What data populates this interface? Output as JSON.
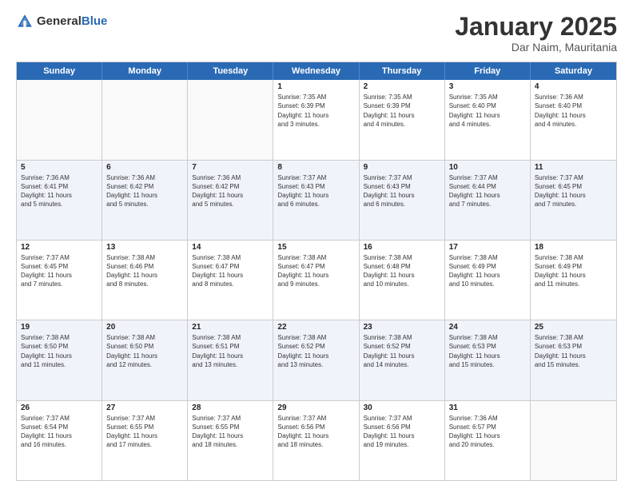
{
  "logo": {
    "general": "General",
    "blue": "Blue"
  },
  "header": {
    "month": "January 2025",
    "location": "Dar Naim, Mauritania"
  },
  "days": [
    "Sunday",
    "Monday",
    "Tuesday",
    "Wednesday",
    "Thursday",
    "Friday",
    "Saturday"
  ],
  "rows": [
    [
      {
        "day": "",
        "lines": []
      },
      {
        "day": "",
        "lines": []
      },
      {
        "day": "",
        "lines": []
      },
      {
        "day": "1",
        "lines": [
          "Sunrise: 7:35 AM",
          "Sunset: 6:39 PM",
          "Daylight: 11 hours",
          "and 3 minutes."
        ]
      },
      {
        "day": "2",
        "lines": [
          "Sunrise: 7:35 AM",
          "Sunset: 6:39 PM",
          "Daylight: 11 hours",
          "and 4 minutes."
        ]
      },
      {
        "day": "3",
        "lines": [
          "Sunrise: 7:35 AM",
          "Sunset: 6:40 PM",
          "Daylight: 11 hours",
          "and 4 minutes."
        ]
      },
      {
        "day": "4",
        "lines": [
          "Sunrise: 7:36 AM",
          "Sunset: 6:40 PM",
          "Daylight: 11 hours",
          "and 4 minutes."
        ]
      }
    ],
    [
      {
        "day": "5",
        "lines": [
          "Sunrise: 7:36 AM",
          "Sunset: 6:41 PM",
          "Daylight: 11 hours",
          "and 5 minutes."
        ]
      },
      {
        "day": "6",
        "lines": [
          "Sunrise: 7:36 AM",
          "Sunset: 6:42 PM",
          "Daylight: 11 hours",
          "and 5 minutes."
        ]
      },
      {
        "day": "7",
        "lines": [
          "Sunrise: 7:36 AM",
          "Sunset: 6:42 PM",
          "Daylight: 11 hours",
          "and 5 minutes."
        ]
      },
      {
        "day": "8",
        "lines": [
          "Sunrise: 7:37 AM",
          "Sunset: 6:43 PM",
          "Daylight: 11 hours",
          "and 6 minutes."
        ]
      },
      {
        "day": "9",
        "lines": [
          "Sunrise: 7:37 AM",
          "Sunset: 6:43 PM",
          "Daylight: 11 hours",
          "and 6 minutes."
        ]
      },
      {
        "day": "10",
        "lines": [
          "Sunrise: 7:37 AM",
          "Sunset: 6:44 PM",
          "Daylight: 11 hours",
          "and 7 minutes."
        ]
      },
      {
        "day": "11",
        "lines": [
          "Sunrise: 7:37 AM",
          "Sunset: 6:45 PM",
          "Daylight: 11 hours",
          "and 7 minutes."
        ]
      }
    ],
    [
      {
        "day": "12",
        "lines": [
          "Sunrise: 7:37 AM",
          "Sunset: 6:45 PM",
          "Daylight: 11 hours",
          "and 7 minutes."
        ]
      },
      {
        "day": "13",
        "lines": [
          "Sunrise: 7:38 AM",
          "Sunset: 6:46 PM",
          "Daylight: 11 hours",
          "and 8 minutes."
        ]
      },
      {
        "day": "14",
        "lines": [
          "Sunrise: 7:38 AM",
          "Sunset: 6:47 PM",
          "Daylight: 11 hours",
          "and 8 minutes."
        ]
      },
      {
        "day": "15",
        "lines": [
          "Sunrise: 7:38 AM",
          "Sunset: 6:47 PM",
          "Daylight: 11 hours",
          "and 9 minutes."
        ]
      },
      {
        "day": "16",
        "lines": [
          "Sunrise: 7:38 AM",
          "Sunset: 6:48 PM",
          "Daylight: 11 hours",
          "and 10 minutes."
        ]
      },
      {
        "day": "17",
        "lines": [
          "Sunrise: 7:38 AM",
          "Sunset: 6:49 PM",
          "Daylight: 11 hours",
          "and 10 minutes."
        ]
      },
      {
        "day": "18",
        "lines": [
          "Sunrise: 7:38 AM",
          "Sunset: 6:49 PM",
          "Daylight: 11 hours",
          "and 11 minutes."
        ]
      }
    ],
    [
      {
        "day": "19",
        "lines": [
          "Sunrise: 7:38 AM",
          "Sunset: 6:50 PM",
          "Daylight: 11 hours",
          "and 11 minutes."
        ]
      },
      {
        "day": "20",
        "lines": [
          "Sunrise: 7:38 AM",
          "Sunset: 6:50 PM",
          "Daylight: 11 hours",
          "and 12 minutes."
        ]
      },
      {
        "day": "21",
        "lines": [
          "Sunrise: 7:38 AM",
          "Sunset: 6:51 PM",
          "Daylight: 11 hours",
          "and 13 minutes."
        ]
      },
      {
        "day": "22",
        "lines": [
          "Sunrise: 7:38 AM",
          "Sunset: 6:52 PM",
          "Daylight: 11 hours",
          "and 13 minutes."
        ]
      },
      {
        "day": "23",
        "lines": [
          "Sunrise: 7:38 AM",
          "Sunset: 6:52 PM",
          "Daylight: 11 hours",
          "and 14 minutes."
        ]
      },
      {
        "day": "24",
        "lines": [
          "Sunrise: 7:38 AM",
          "Sunset: 6:53 PM",
          "Daylight: 11 hours",
          "and 15 minutes."
        ]
      },
      {
        "day": "25",
        "lines": [
          "Sunrise: 7:38 AM",
          "Sunset: 6:53 PM",
          "Daylight: 11 hours",
          "and 15 minutes."
        ]
      }
    ],
    [
      {
        "day": "26",
        "lines": [
          "Sunrise: 7:37 AM",
          "Sunset: 6:54 PM",
          "Daylight: 11 hours",
          "and 16 minutes."
        ]
      },
      {
        "day": "27",
        "lines": [
          "Sunrise: 7:37 AM",
          "Sunset: 6:55 PM",
          "Daylight: 11 hours",
          "and 17 minutes."
        ]
      },
      {
        "day": "28",
        "lines": [
          "Sunrise: 7:37 AM",
          "Sunset: 6:55 PM",
          "Daylight: 11 hours",
          "and 18 minutes."
        ]
      },
      {
        "day": "29",
        "lines": [
          "Sunrise: 7:37 AM",
          "Sunset: 6:56 PM",
          "Daylight: 11 hours",
          "and 18 minutes."
        ]
      },
      {
        "day": "30",
        "lines": [
          "Sunrise: 7:37 AM",
          "Sunset: 6:56 PM",
          "Daylight: 11 hours",
          "and 19 minutes."
        ]
      },
      {
        "day": "31",
        "lines": [
          "Sunrise: 7:36 AM",
          "Sunset: 6:57 PM",
          "Daylight: 11 hours",
          "and 20 minutes."
        ]
      },
      {
        "day": "",
        "lines": []
      }
    ]
  ]
}
